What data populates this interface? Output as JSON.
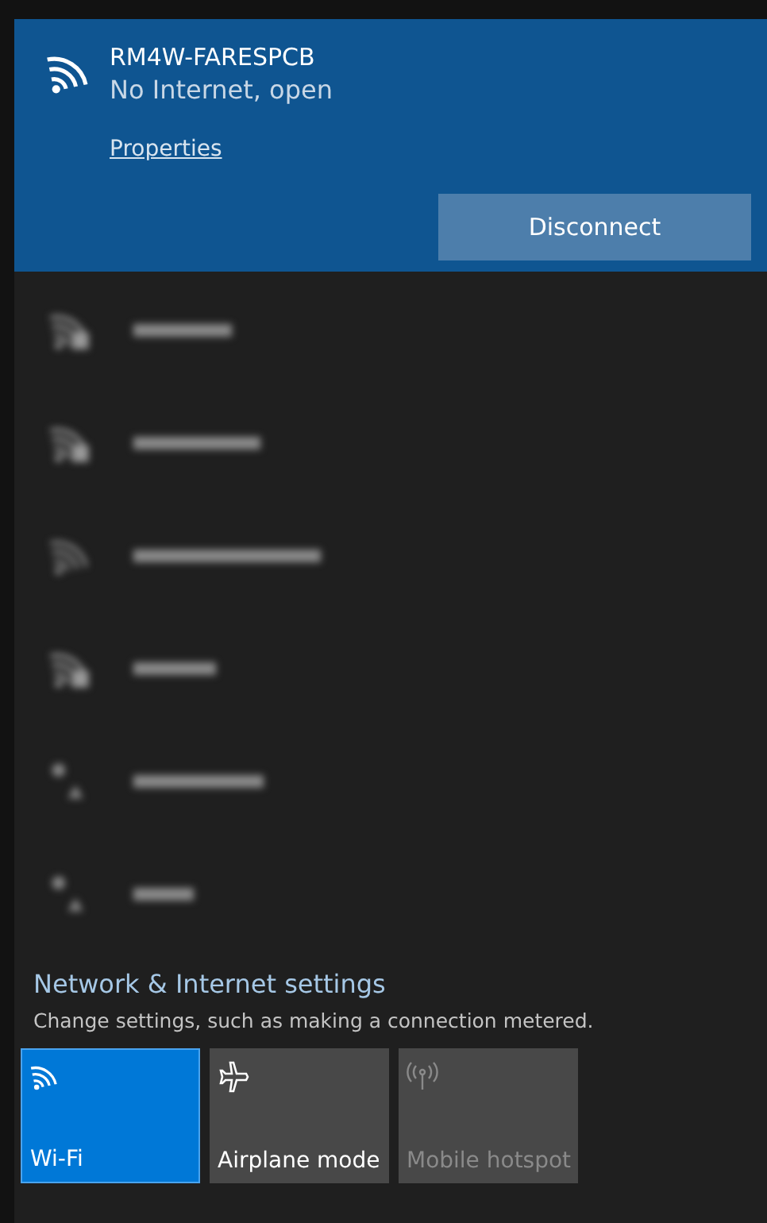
{
  "connected": {
    "name": "RM4W-FARESPCB",
    "status": "No Internet, open",
    "link": "Properties",
    "button": "Disconnect"
  },
  "networks": [
    {
      "kind": "secured"
    },
    {
      "kind": "secured"
    },
    {
      "kind": "open"
    },
    {
      "kind": "secured"
    },
    {
      "kind": "weak"
    },
    {
      "kind": "weak"
    }
  ],
  "settings": {
    "title": "Network & Internet settings",
    "subtitle": "Change settings, such as making a connection metered."
  },
  "tiles": [
    {
      "kind": "wifi",
      "label": "Wi-Fi",
      "on": true,
      "disabled": false
    },
    {
      "kind": "airplane",
      "label": "Airplane mode",
      "on": false,
      "disabled": false
    },
    {
      "kind": "hotspot",
      "label": "Mobile hotspot",
      "on": false,
      "disabled": true
    }
  ]
}
